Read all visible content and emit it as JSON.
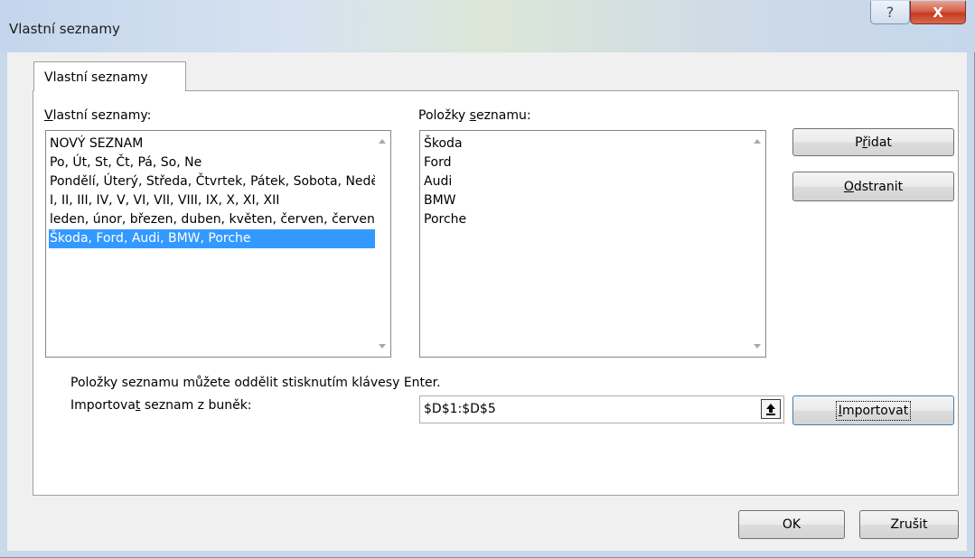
{
  "window": {
    "title": "Vlastní seznamy",
    "help_label": "?",
    "close_label": "X"
  },
  "tab": {
    "label": "Vlastní seznamy"
  },
  "custom_lists": {
    "label_underlined": "V",
    "label_rest": "lastní seznamy:",
    "items": [
      "NOVÝ SEZNAM",
      "Po, Út, St, Čt, Pá, So, Ne",
      "Pondělí, Úterý, Středa, Čtvrtek, Pátek, Sobota, Neděle",
      "I, II, III, IV, V, VI, VII, VIII, IX, X, XI, XII",
      "leden, únor, březen, duben, květen, červen, červenec",
      "Škoda, Ford, Audi, BMW, Porche"
    ],
    "selected_index": 5
  },
  "list_entries": {
    "label_before": "Položky ",
    "label_underlined": "s",
    "label_after": "eznamu:",
    "items": [
      "Škoda",
      "Ford",
      "Audi",
      "BMW",
      "Porche"
    ]
  },
  "buttons": {
    "add_before": "P",
    "add_underlined": "ř",
    "add_after": "idat",
    "delete_underlined": "O",
    "delete_after": "dstranit",
    "import_underlined": "I",
    "import_after": "mportovat",
    "ok": "OK",
    "cancel": "Zrušit"
  },
  "hint": "Položky seznamu můžete oddělit stisknutím klávesy Enter.",
  "import": {
    "label_before": "Importova",
    "label_underlined": "t",
    "label_after": " seznam z buněk:",
    "value": "$D$1:$D$5"
  }
}
